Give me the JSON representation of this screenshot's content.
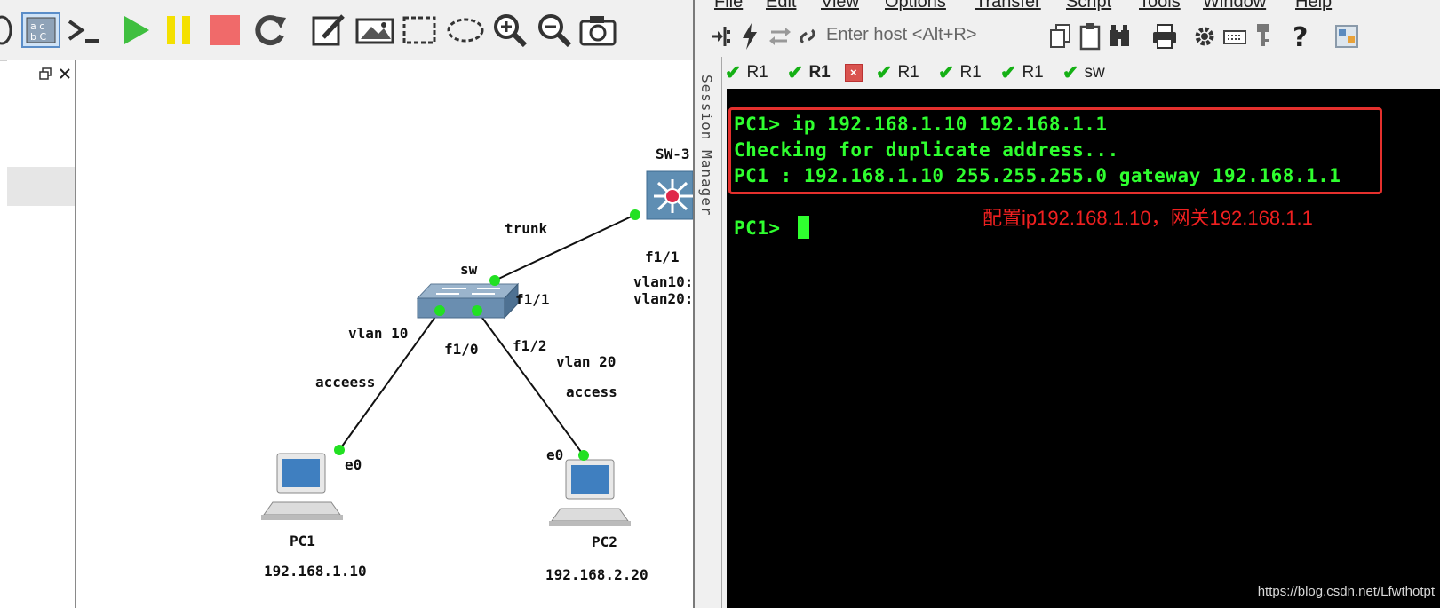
{
  "gns3": {
    "topology": {
      "node_sw3": "SW-3",
      "node_sw": "sw",
      "node_pc1": "PC1",
      "node_pc2": "PC2",
      "link_trunk": "trunk",
      "port_sw3_f1_1": "f1/1",
      "sw3_vlan10": "vlan10:",
      "sw3_vlan20": "vlan20:",
      "port_sw_f1_1": "f1/1",
      "port_sw_f1_0": "f1/0",
      "port_sw_f1_2": "f1/2",
      "vlan_10": "vlan 10",
      "vlan_20": "vlan 20",
      "mode_pc1": "acceess",
      "mode_pc2": "access",
      "port_pc1_e0": "e0",
      "port_pc2_e0": "e0",
      "ip_pc1": "192.168.1.10",
      "ip_pc2": "192.168.2.20"
    },
    "colors": {
      "port_dot": "#22e022",
      "link": "#111111"
    }
  },
  "crt": {
    "menu": [
      "File",
      "Edit",
      "View",
      "Options",
      "Transfer",
      "Script",
      "Tools",
      "Window",
      "Help"
    ],
    "host_placeholder": "Enter host <Alt+R>",
    "session_manager_label": "Session Manager",
    "tabs": [
      {
        "label": "R1",
        "status": "connected"
      },
      {
        "label": "R1",
        "status": "connected",
        "active": true
      },
      {
        "label": "R1",
        "status": "connected"
      },
      {
        "label": "R1",
        "status": "connected"
      },
      {
        "label": "R1",
        "status": "connected"
      },
      {
        "label": "sw",
        "status": "connected"
      }
    ],
    "terminal": {
      "lines": [
        "PC1> ip 192.168.1.10 192.168.1.1",
        "Checking for duplicate address...",
        "PC1 : 192.168.1.10 255.255.255.0 gateway 192.168.1.1"
      ],
      "prompt": "PC1> ",
      "annotation": "配置ip192.168.1.10，网关192.168.1.1"
    },
    "watermark": "https://blog.csdn.net/Lfwthotpt",
    "colors": {
      "terminal_text": "#2fff2f",
      "highlight_box": "#e4302d",
      "annotation": "#f02020"
    }
  }
}
